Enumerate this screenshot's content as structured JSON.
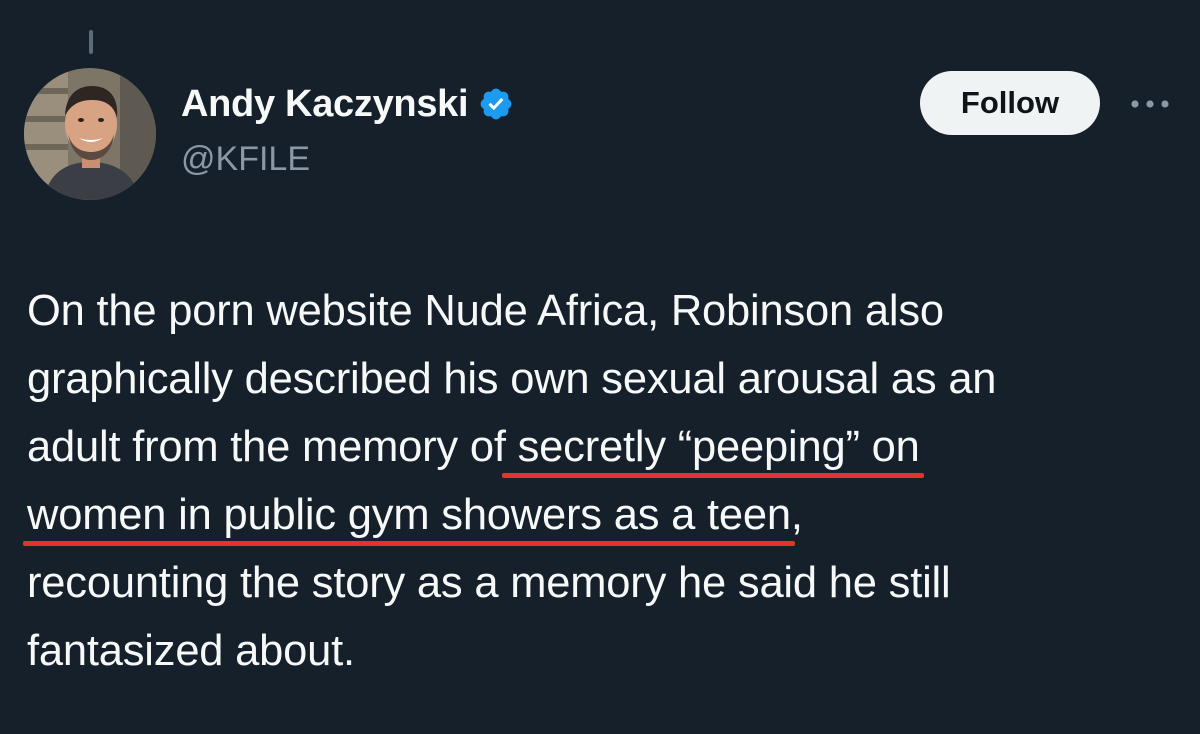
{
  "author": {
    "display_name": "Andy Kaczynski",
    "handle": "@KFILE",
    "verified": true,
    "avatar": "profile-photo"
  },
  "actions": {
    "follow_label": "Follow",
    "more_icon": "more-horizontal-icon"
  },
  "tweet": {
    "lines": [
      {
        "before": "On the porn website Nude Africa, Robinson also",
        "underlined": "",
        "after": ""
      },
      {
        "before": "graphically described his own sexual arousal as an",
        "underlined": "",
        "after": ""
      },
      {
        "before": "adult from the memory of",
        "underlined": " secretly “peeping” on",
        "after": ""
      },
      {
        "before": "",
        "underlined": "women in public gym showers as a teen",
        "after": ","
      },
      {
        "before": "recounting the story as a memory he said he still",
        "underlined": "",
        "after": ""
      },
      {
        "before": "fantasized about.",
        "underlined": "",
        "after": ""
      }
    ]
  },
  "colors": {
    "background": "#15202b",
    "text": "#f7f9f9",
    "secondary_text": "#8b98a5",
    "verified_blue": "#1d9bf0",
    "annotation_underline": "#e8302f",
    "follow_button_bg": "#eff3f4"
  }
}
